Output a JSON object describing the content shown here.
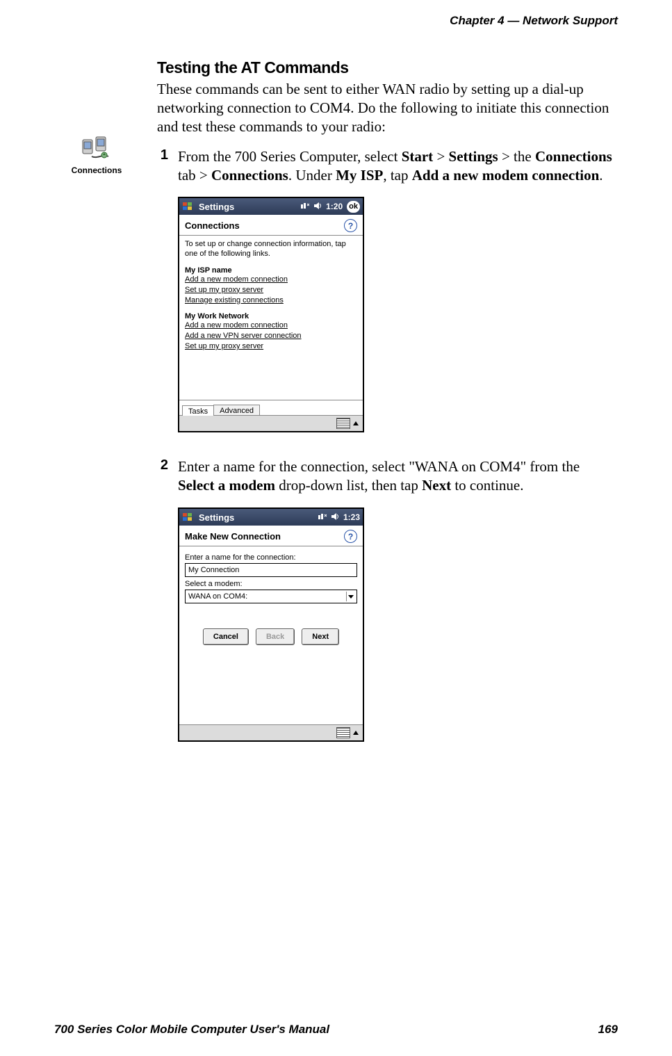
{
  "header": {
    "chapter_label": "Chapter  4",
    "sep": "  —  ",
    "chapter_name": "Network Support"
  },
  "section_title": "Testing the AT Commands",
  "intro": "These commands can be sent to either WAN radio by setting up a dial-up networking connection to COM4. Do the following to initiate this connection and test these commands to your radio:",
  "side_icon_label": "Connections",
  "step1": {
    "num": "1",
    "pre": "From the 700 Series Computer, select ",
    "b1": "Start",
    "gt1": " > ",
    "b2": "Settings",
    "gt2": " > the ",
    "b3": "Connections",
    "mid1": " tab > ",
    "b4": "Connections",
    "mid2": ". Under ",
    "b5": "My ISP",
    "mid3": ", tap ",
    "b6": "Add a new modem connection",
    "tail": "."
  },
  "step2": {
    "num": "2",
    "pre": "Enter a name for the connection, select \"WANA on COM4\" from the ",
    "b1": "Select a modem",
    "mid": " drop-down list, then tap ",
    "b2": "Next",
    "tail": " to continue."
  },
  "shot1": {
    "title": "Settings",
    "time": "1:20",
    "subtitle": "Connections",
    "desc": "To set up or change connection information, tap one of the following links.",
    "isp_head": "My ISP name",
    "isp_links": [
      "Add a new modem connection",
      "Set up my proxy server",
      "Manage existing connections"
    ],
    "work_head": "My Work Network",
    "work_links": [
      "Add a new modem connection",
      "Add a new VPN server connection",
      "Set up my proxy server"
    ],
    "tabs": [
      "Tasks",
      "Advanced"
    ],
    "ok": "ok"
  },
  "shot2": {
    "title": "Settings",
    "time": "1:23",
    "subtitle": "Make New Connection",
    "name_label": "Enter a name for the connection:",
    "name_value": "My Connection",
    "modem_label": "Select a modem:",
    "modem_value": "WANA on COM4:",
    "buttons": {
      "cancel": "Cancel",
      "back": "Back",
      "next": "Next"
    }
  },
  "footer": {
    "left": "700 Series Color Mobile Computer User's Manual",
    "right": "169"
  }
}
